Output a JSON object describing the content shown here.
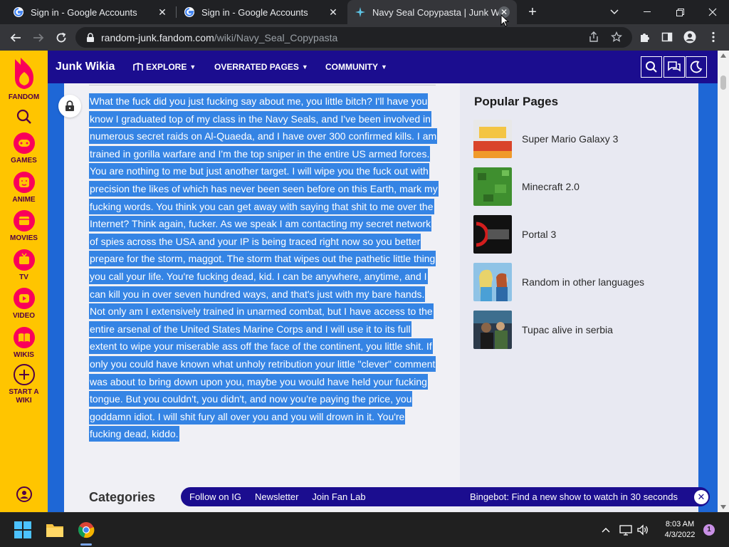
{
  "browser": {
    "tabs": [
      {
        "title": "Sign in - Google Accounts",
        "favicon": "google-icon",
        "active": false
      },
      {
        "title": "Sign in - Google Accounts",
        "favicon": "google-icon",
        "active": false
      },
      {
        "title": "Navy Seal Copypasta | Junk Wikia",
        "favicon": "fandom-icon",
        "active": true
      }
    ],
    "url_host": "random-junk.fandom.com",
    "url_path": "/wiki/Navy_Seal_Copypasta"
  },
  "fandom_rail": {
    "brand": "FANDOM",
    "items": [
      {
        "label": "GAMES",
        "icon": "gamepad-icon"
      },
      {
        "label": "ANIME",
        "icon": "anime-face-icon"
      },
      {
        "label": "MOVIES",
        "icon": "clapper-icon"
      },
      {
        "label": "TV",
        "icon": "tv-icon"
      },
      {
        "label": "VIDEO",
        "icon": "play-icon"
      },
      {
        "label": "WIKIS",
        "icon": "book-icon"
      },
      {
        "label": "START A WIKI",
        "icon": "plus-circle-icon"
      }
    ]
  },
  "wiki_nav": {
    "title": "Junk Wikia",
    "explore": "EXPLORE",
    "overrated": "OVERRATED PAGES",
    "community": "COMMUNITY"
  },
  "article": {
    "text": "What the fuck did you just fucking say about me, you little bitch? I'll have you know I graduated top of my class in the Navy Seals, and I've been involved in numerous secret raids on Al-Quaeda, and I have over 300 confirmed kills. I am trained in gorilla warfare and I'm the top sniper in the entire US armed forces. You are nothing to me but just another target. I will wipe you the fuck out with precision the likes of which has never been seen before on this Earth, mark my fucking words. You think you can get away with saying that shit to me over the Internet? Think again, fucker. As we speak I am contacting my secret network of spies across the USA and your IP is being traced right now so you better prepare for the storm, maggot. The storm that wipes out the pathetic little thing you call your life. You're fucking dead, kid. I can be anywhere, anytime, and I can kill you in over seven hundred ways, and that's just with my bare hands. Not only am I extensively trained in unarmed combat, but I have access to the entire arsenal of the United States Marine Corps and I will use it to its full extent to wipe your miserable ass off the face of the continent, you little shit. If only you could have known what unholy retribution your little \"clever\" comment was about to bring down upon you, maybe you would have held your fucking tongue. But you couldn't, you didn't, and now you're paying the price, you goddamn idiot. I will shit fury all over you and you will drown in it. You're fucking dead, kiddo."
  },
  "popular_pages": {
    "title": "Popular Pages",
    "items": [
      {
        "label": "Super Mario Galaxy 3"
      },
      {
        "label": "Minecraft 2.0"
      },
      {
        "label": "Portal 3"
      },
      {
        "label": "Random in other languages"
      },
      {
        "label": "Tupac alive in serbia"
      }
    ]
  },
  "footer": {
    "categories": "Categories",
    "links": [
      "Follow on IG",
      "Newsletter",
      "Join Fan Lab"
    ],
    "promo": "Bingebot: Find a new show to watch in 30 seconds"
  },
  "taskbar": {
    "time": "8:03 AM",
    "date": "4/3/2022",
    "notifications": "1"
  },
  "colors": {
    "fandom_yellow": "#ffc500",
    "wiki_navy": "#1b0d8f",
    "selection_blue": "#3584e4",
    "page_blue": "#1e67d6"
  }
}
